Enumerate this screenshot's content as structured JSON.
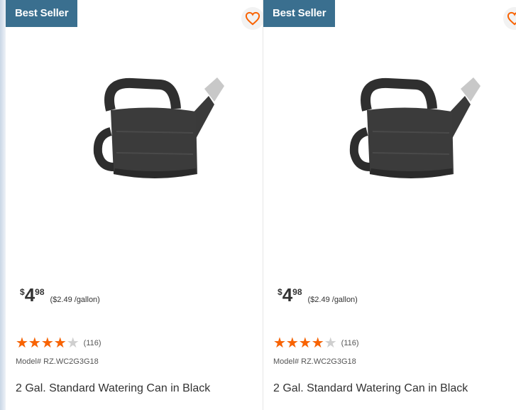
{
  "products": [
    {
      "badge": "Best Seller",
      "price_symbol": "$",
      "price_dollars": "4",
      "price_cents": "98",
      "unit_price": "($2.49 /gallon)",
      "rating_fraction": 0.8,
      "review_count": "(116)",
      "model": "Model# RZ.WC2G3G18",
      "title": "2 Gal. Standard Watering Can in Black",
      "favorite_icon": "heart-outline-icon"
    },
    {
      "badge": "Best Seller",
      "price_symbol": "$",
      "price_dollars": "4",
      "price_cents": "98",
      "unit_price": "($2.49 /gallon)",
      "rating_fraction": 0.8,
      "review_count": "(116)",
      "model": "Model# RZ.WC2G3G18",
      "title": "2 Gal. Standard Watering Can in Black",
      "favorite_icon": "heart-outline-icon"
    }
  ],
  "colors": {
    "badge_bg": "#3a6f8f",
    "star": "#f96302",
    "heart": "#f96302"
  }
}
